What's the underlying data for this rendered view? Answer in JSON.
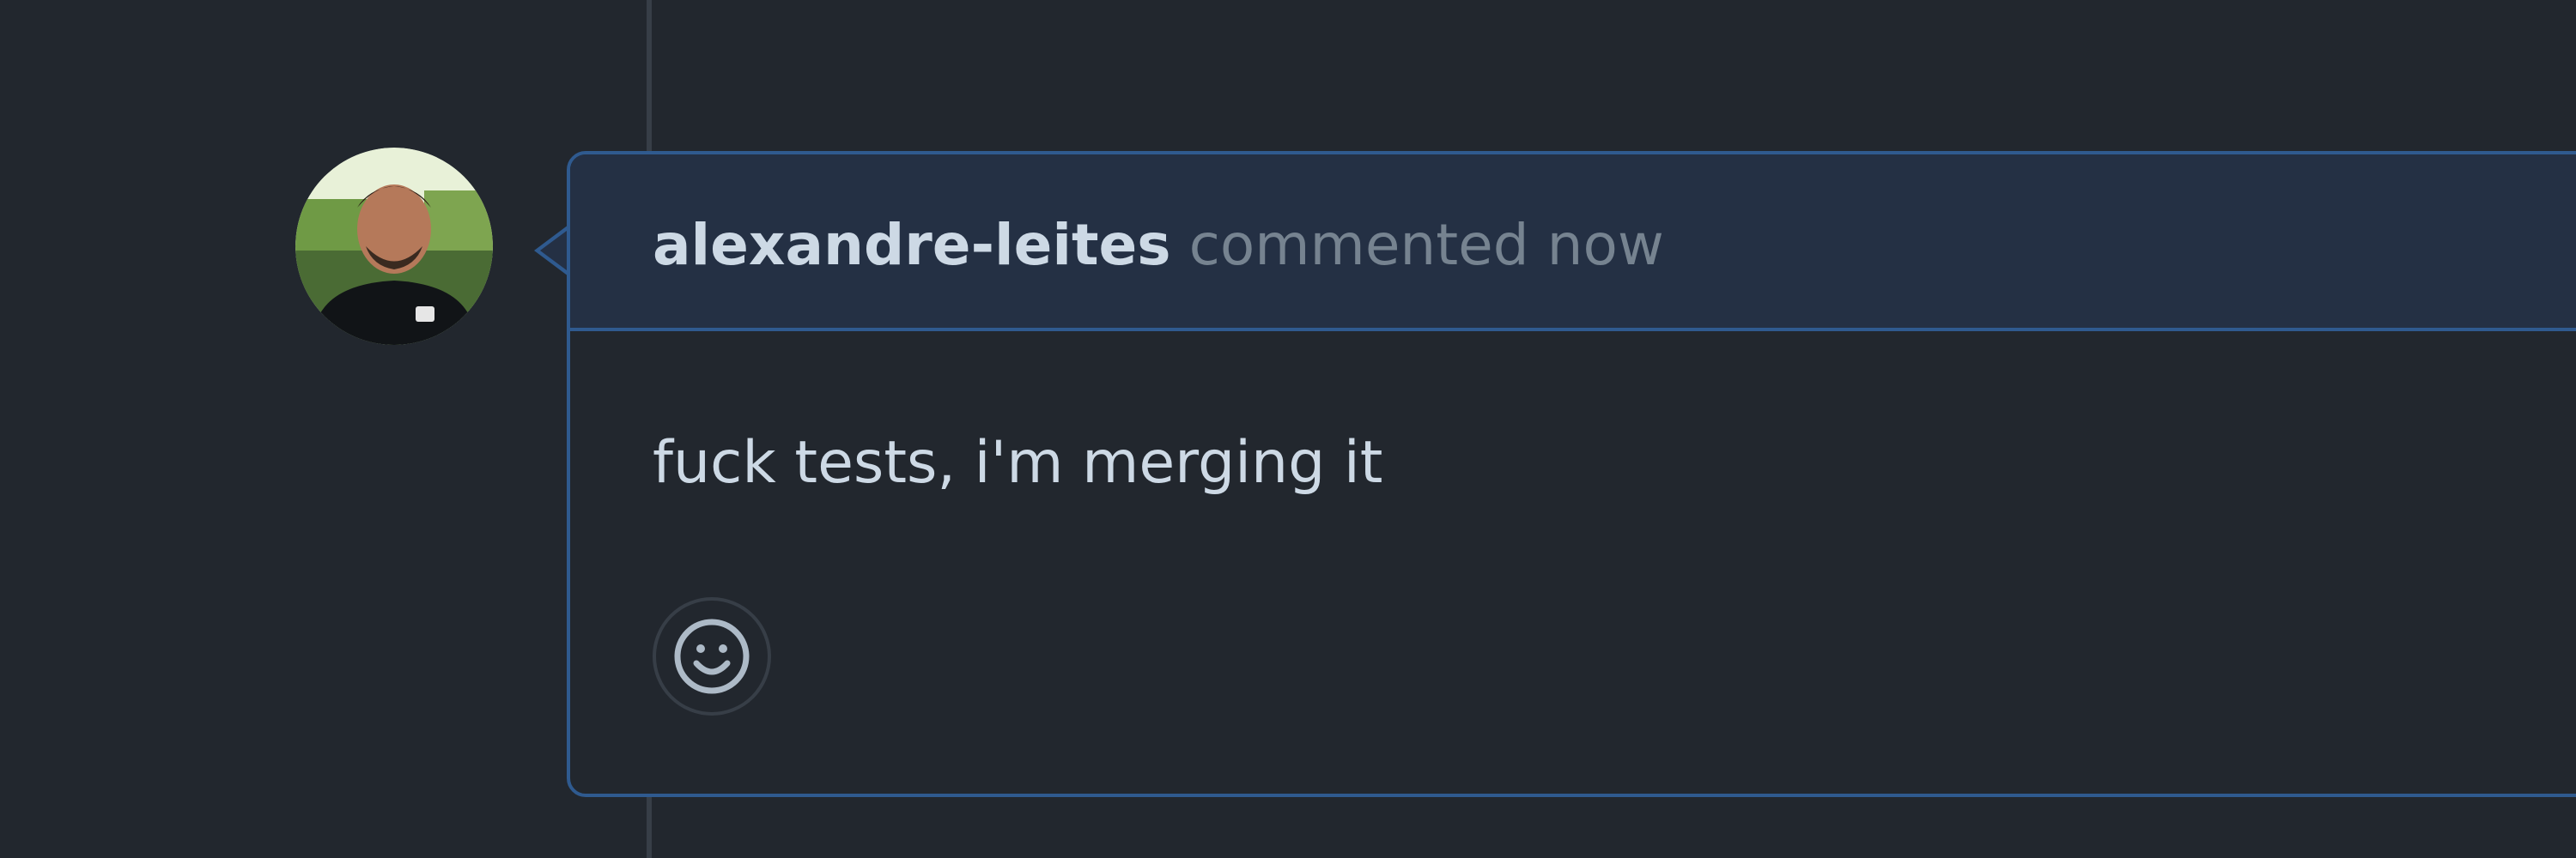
{
  "comment": {
    "author": "alexandre-leites",
    "action": "commented",
    "timestamp": "now",
    "body": "fuck tests, i'm merging it"
  },
  "avatar": {
    "icon": "user-avatar-photo"
  },
  "reaction": {
    "icon": "smiley-icon"
  },
  "colors": {
    "background": "#22272e",
    "header_background": "#243044",
    "border_accent": "#2f5a8f",
    "text_primary": "#cdd9e5",
    "text_muted": "#768390"
  }
}
